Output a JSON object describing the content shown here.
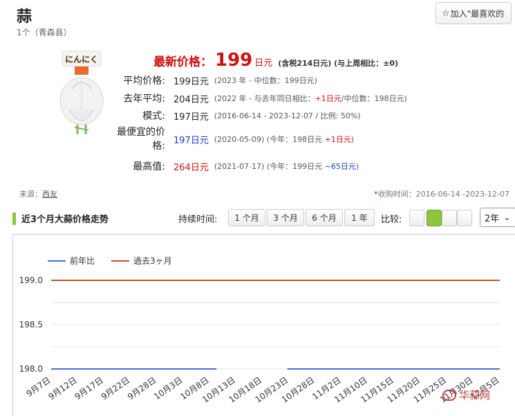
{
  "product": {
    "title": "蒜",
    "subtitle": "1个（青森县）",
    "image_label": "にんにく",
    "favorite_label": "加入\"最喜欢的"
  },
  "latest": {
    "label": "最新价格：",
    "value": "199",
    "unit": "日元",
    "note": "(含税214日元)  (与上周相比：±0)"
  },
  "stats": {
    "avg_label": "平均价格:",
    "avg_value": "199日元",
    "avg_sub": "(2023 年 - 中位数：199日元)",
    "lastyear_label": "去年平均:",
    "lastyear_value": "204日元",
    "lastyear_sub_a": "(2022 年 - 与去年同日相比：",
    "lastyear_sub_b": "+1日元",
    "lastyear_sub_c": "/中位数：198日元)",
    "mode_label": "模式:",
    "mode_value": "197日元",
    "mode_sub": "(2016-06-14 - 2023-12-07 / 比例: 50%)",
    "cheap_label_1": "最便宜的价",
    "cheap_label_2": "格:",
    "cheap_value": "197日元",
    "cheap_sub_a": "(2020-05-09) (今年：198日元",
    "cheap_sub_b": "+1日元",
    "cheap_sub_c": ")",
    "high_label": "最高值:",
    "high_value": "264日元",
    "high_sub_a": "(2021-07-17) (今年：199日元",
    "high_sub_b": "~65日元",
    "high_sub_c": ")"
  },
  "source": {
    "label": "来源：",
    "name": "西友"
  },
  "period": {
    "asterisk": "*",
    "text": "收购时间：2016-06-14 -2023-12-07"
  },
  "trend": {
    "title": "近3个月大蒜价格走势",
    "duration_label": "持续时间:",
    "durations": [
      "1 个月",
      "3 个月",
      "6 个月",
      "1 年"
    ],
    "compare_label": "比较:",
    "year_select": "2年",
    "chevron": "⌄"
  },
  "colors": {
    "accent_green": "#8cc63f",
    "price_red": "#d01010",
    "series_blue": "#4a6cd4",
    "series_orange": "#c8501e"
  },
  "watermark": "华蒜网",
  "chart_data": {
    "type": "line",
    "series": [
      {
        "name": "前年比",
        "color": "#4a6cd4",
        "values": [
          198.0,
          198.0,
          198.0,
          198.0,
          198.0,
          198.0,
          198.0,
          198.0,
          null,
          null,
          198.0,
          198.0,
          198.0,
          198.0,
          198.0,
          198.0,
          198.0,
          198.0,
          198.0,
          198.0
        ]
      },
      {
        "name": "過去3ヶ月",
        "color": "#c8501e",
        "values": [
          199.0,
          199.0,
          199.0,
          199.0,
          199.0,
          199.0,
          199.0,
          199.0,
          199.0,
          199.0,
          199.0,
          199.0,
          199.0,
          199.0,
          199.0,
          199.0,
          199.0,
          199.0,
          199.0,
          199.0
        ]
      }
    ],
    "categories": [
      "9月7日",
      "9月12日",
      "9月17日",
      "9月22日",
      "9月28日",
      "10月3日",
      "10月8日",
      "10月13日",
      "10月18日",
      "10月23日",
      "10月28日",
      "11月2日",
      "11月10日",
      "11月15日",
      "11月20日",
      "11月25日",
      "11月30日",
      "12月5日"
    ],
    "yticks": [
      "199.0",
      "198.5",
      "198.0"
    ],
    "ylim": [
      198.0,
      199.0
    ],
    "legend_position": "top-left",
    "grid": true
  }
}
